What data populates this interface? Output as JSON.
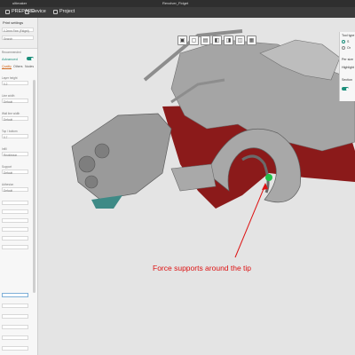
{
  "titlebar": {
    "left": "ultimaker",
    "center": "Revolver_Fidget"
  },
  "menubar": {
    "prepare": "PREPARE",
    "device": "Device",
    "project": "Project"
  },
  "sidebar": {
    "print_settings_label": "Print settings",
    "profile_value": "0.2mm Fine (Fidget)",
    "recommended_label": "Recommended",
    "advanced_label": "Advanced",
    "search_placeholder": "Search",
    "tabs": [
      "Quality",
      "Others",
      "Nodes"
    ],
    "fields": [
      {
        "label": "Layer height",
        "value": "0.2"
      },
      {
        "label": "Line width",
        "value": "Default"
      },
      {
        "label": "Wall line width",
        "value": "Default"
      },
      {
        "label": "Top / bottom",
        "value": "0.7"
      },
      {
        "label": "Infill",
        "value": "Rectilinear"
      },
      {
        "label": "Support",
        "value": "Default"
      },
      {
        "label": "Adhesion",
        "value": "Default"
      }
    ]
  },
  "right_panel": {
    "title": "Tool type",
    "option1": "S",
    "option2": "Or",
    "per_size": "Per size",
    "highlight": "Highlight",
    "section": "Section"
  },
  "annotation": {
    "text": "Force supports around the tip"
  },
  "colors": {
    "accent": "#1c8f7b",
    "annotation": "#dd1111",
    "model": "#9e9e9e",
    "support": "#8b1a1a"
  },
  "icons": [
    "rotate-icon",
    "scale-icon",
    "mirror-icon",
    "support-icon",
    "layer-icon"
  ]
}
